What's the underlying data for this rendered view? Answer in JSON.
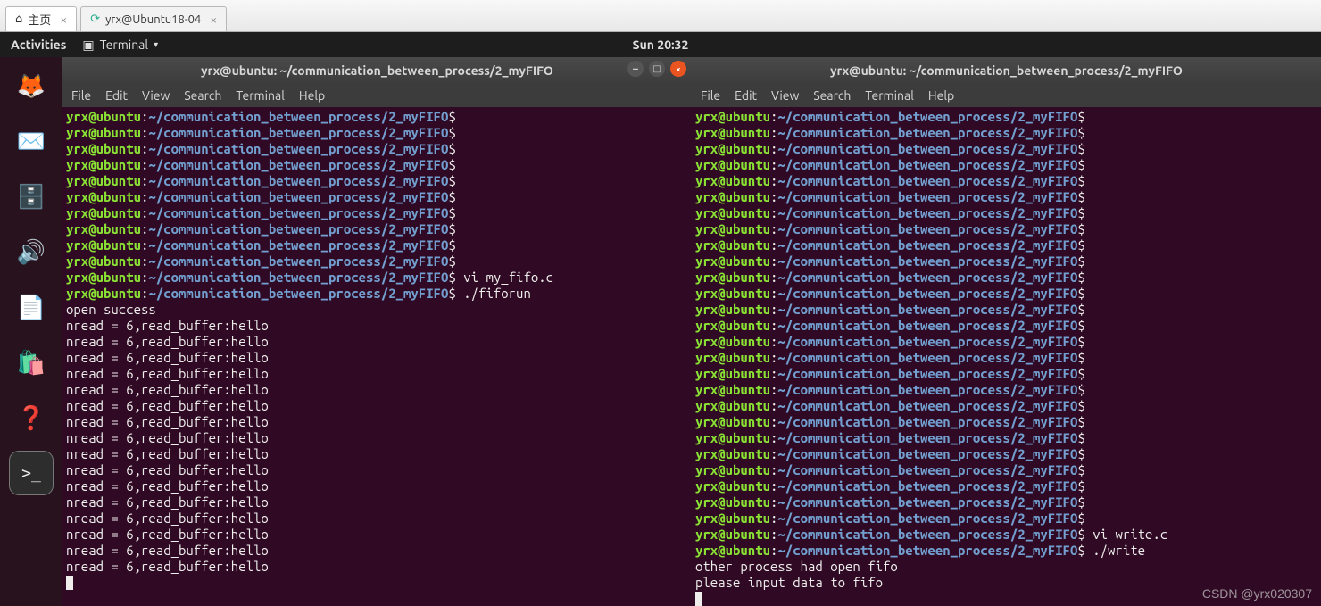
{
  "browser_tabs": [
    {
      "label": "主页",
      "icon": "⌂"
    },
    {
      "label": "yrx@Ubuntu18-04",
      "icon": "⟳"
    }
  ],
  "topbar": {
    "activities": "Activities",
    "app_icon": "▣",
    "app_name": "Terminal",
    "clock": "Sun 20:32"
  },
  "dock": [
    {
      "name": "firefox-icon",
      "glyph": "🦊",
      "color": ""
    },
    {
      "name": "thunderbird-icon",
      "glyph": "✉️",
      "color": "#1e5fb4"
    },
    {
      "name": "files-icon",
      "glyph": "🗄️",
      "color": ""
    },
    {
      "name": "rhythmbox-icon",
      "glyph": "🔊",
      "color": ""
    },
    {
      "name": "writer-icon",
      "glyph": "📄",
      "color": ""
    },
    {
      "name": "software-icon",
      "glyph": "🛍️",
      "color": "#e95420"
    },
    {
      "name": "help-icon",
      "glyph": "❓",
      "color": "#3a87d2"
    },
    {
      "name": "terminal-icon",
      "glyph": ">_",
      "color": "#2d2d2d",
      "active": true
    }
  ],
  "menubar": [
    "File",
    "Edit",
    "View",
    "Search",
    "Terminal",
    "Help"
  ],
  "prompt": {
    "user_host": "yrx@ubuntu",
    "sep": ":",
    "path": "~/communication_between_process/2_myFIFO",
    "suffix": "$"
  },
  "left": {
    "title": "yrx@ubuntu: ~/communication_between_process/2_myFIFO",
    "blank_prompts": 10,
    "cmd1": " vi my_fifo.c",
    "cmd2": " ./fiforun",
    "out_open": "open success",
    "out_line": "nread = 6,read_buffer:hello",
    "out_repeat": 16
  },
  "right": {
    "title": "yrx@ubuntu: ~/communication_between_process/2_myFIFO",
    "blank_prompts": 26,
    "cmd1": " vi write.c",
    "cmd2": " ./write",
    "out1": "other process had open fifo",
    "out2": "please input data to fifo"
  },
  "watermark": "CSDN @yrx020307"
}
